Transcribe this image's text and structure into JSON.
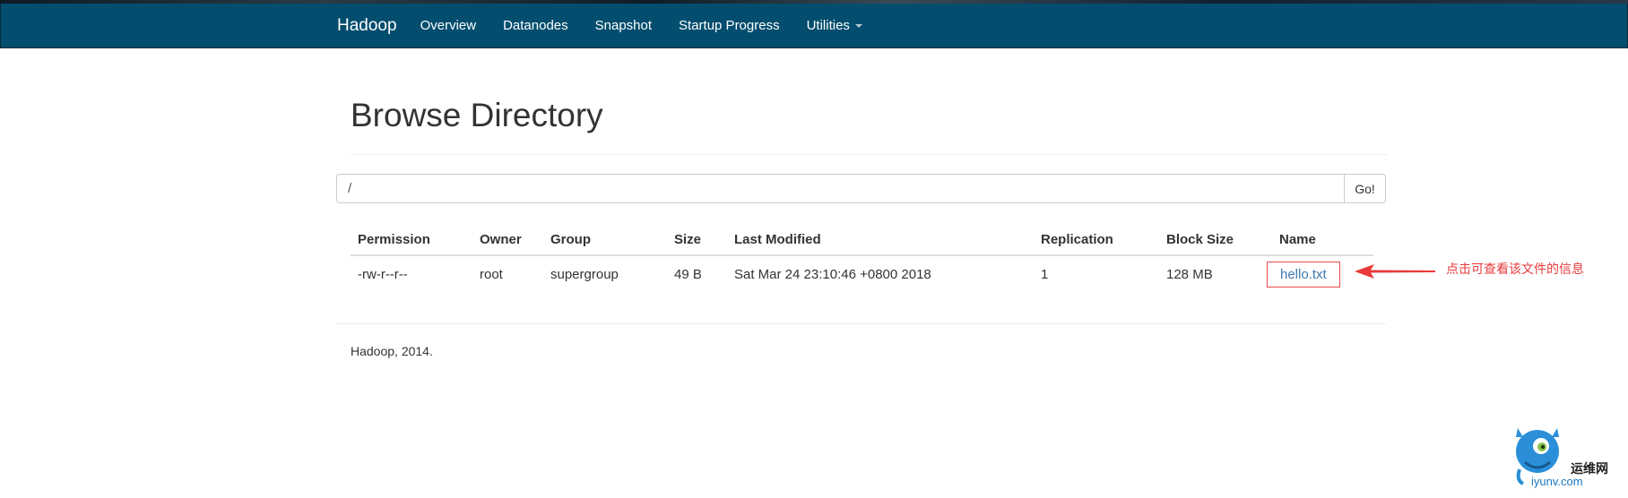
{
  "navbar": {
    "brand": "Hadoop",
    "items": [
      {
        "label": "Overview"
      },
      {
        "label": "Datanodes"
      },
      {
        "label": "Snapshot"
      },
      {
        "label": "Startup Progress"
      },
      {
        "label": "Utilities"
      }
    ]
  },
  "page": {
    "title": "Browse Directory",
    "path_value": "/",
    "go_label": "Go!"
  },
  "table": {
    "headers": [
      "Permission",
      "Owner",
      "Group",
      "Size",
      "Last Modified",
      "Replication",
      "Block Size",
      "Name"
    ],
    "rows": [
      {
        "permission": "-rw-r--r--",
        "owner": "root",
        "group": "supergroup",
        "size": "49 B",
        "last_modified": "Sat Mar 24 23:10:46 +0800 2018",
        "replication": "1",
        "block_size": "128 MB",
        "name": "hello.txt"
      }
    ]
  },
  "annotation": {
    "text": "点击可查看该文件的信息",
    "color": "#e83a3a"
  },
  "footer": {
    "text": "Hadoop, 2014."
  },
  "watermark": {
    "site_name": "运维网",
    "url": "iyunv.com"
  },
  "colors": {
    "navbar_bg": "#034d6e",
    "link": "#3d79b0",
    "highlight": "#e84a4a"
  }
}
